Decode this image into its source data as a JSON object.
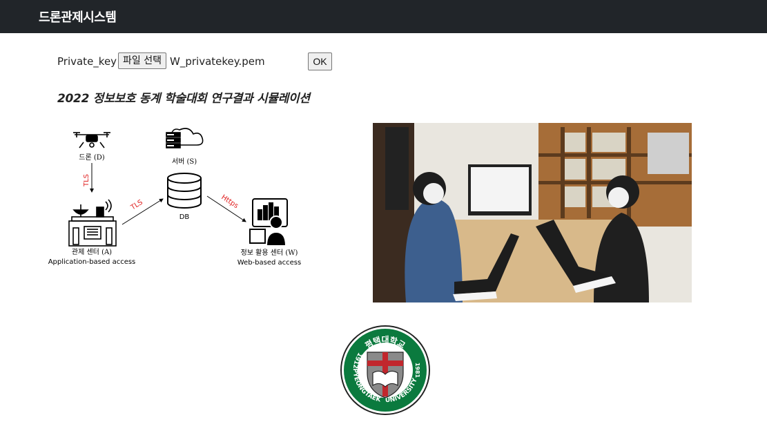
{
  "app": {
    "title": "드론관제시스템"
  },
  "key_form": {
    "label": "Private_key :",
    "file_button_label": "파일 선택",
    "file_name": "W_privatekey.pem",
    "ok_label": "OK"
  },
  "headline": "2022 정보보호 동계 학술대회 연구결과 시뮬레이션",
  "diagram": {
    "drone_label": "드론 (D)",
    "server_label": "서버 (S)",
    "db_label": "DB",
    "control_label": "관제 센터 (A)",
    "control_sub": "Application-based access",
    "info_label": "정보 활용 센터 (W)",
    "info_sub": "Web-based access",
    "edge_drone_control": "TLS",
    "edge_control_db": "TLS",
    "edge_db_info": "Https",
    "edge_color": "#e02020"
  },
  "logo": {
    "top_text": "평택대학교",
    "left_text": "1912PYEONGTAEK",
    "right_text": "UNIVERSITY",
    "year_right": "1981",
    "ring_color": "#0b7a3e"
  },
  "colors": {
    "topbar": "#212529"
  }
}
